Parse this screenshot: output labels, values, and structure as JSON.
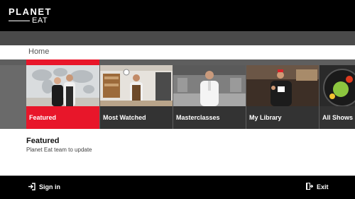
{
  "header": {
    "logo_top": "PLANET",
    "logo_bottom": "EAT"
  },
  "breadcrumb": "Home",
  "rail": {
    "selected_index": 0,
    "tiles": [
      {
        "label": "Featured",
        "image": "two-chefs-with-world-map"
      },
      {
        "label": "Most Watched",
        "image": "chef-in-apron-kitchen"
      },
      {
        "label": "Masterclasses",
        "image": "chef-in-whites-kitchen"
      },
      {
        "label": "My Library",
        "image": "chef-with-cup"
      },
      {
        "label": "All Shows",
        "image": "food-bowl"
      }
    ]
  },
  "info": {
    "title": "Featured",
    "description": "Planet Eat team to update"
  },
  "footer": {
    "signin_label": "Sign in",
    "exit_label": "Exit",
    "signin_icon": "sign-in-icon",
    "exit_icon": "exit-icon"
  },
  "colors": {
    "accent": "#e8162a",
    "bar": "#000000",
    "rail": "#5e5e5e"
  }
}
